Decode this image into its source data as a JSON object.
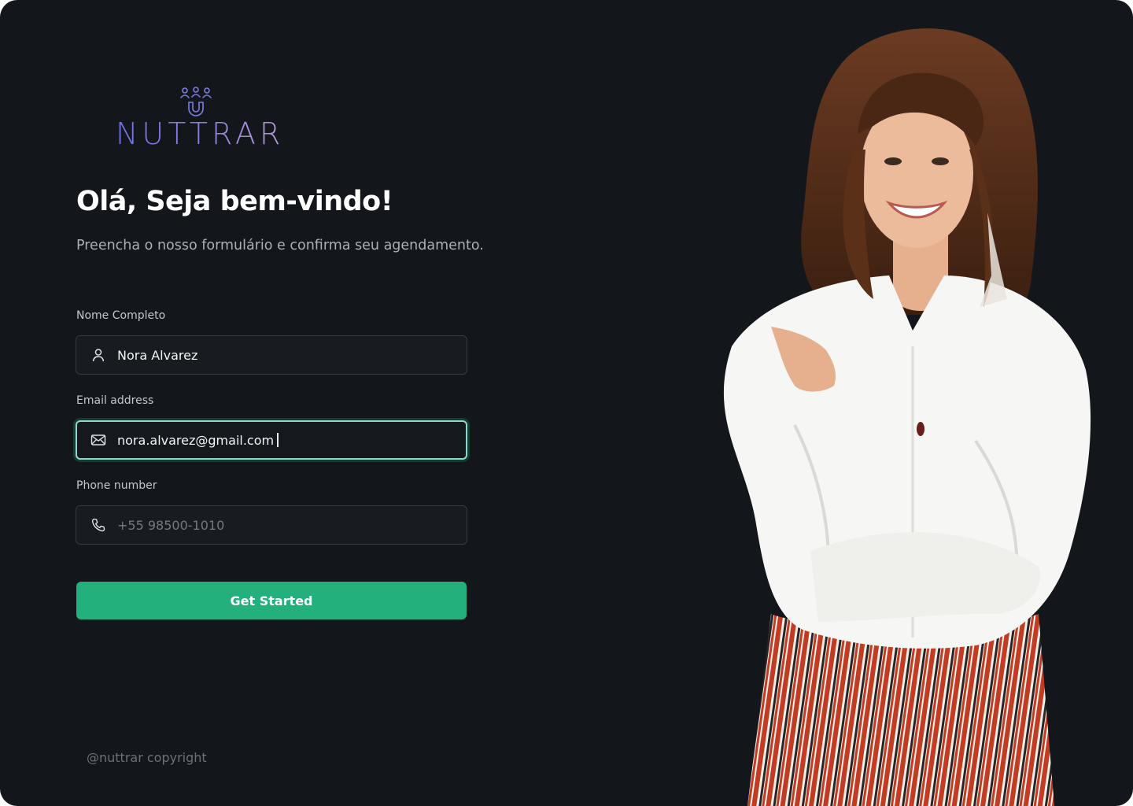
{
  "brand": {
    "name": "NUTTRAR",
    "logo_icon": "people-magnet-icon",
    "colors": {
      "primary": "#6f72e8",
      "accent": "#b79ad8"
    }
  },
  "hero": {
    "title": "Olá, Seja bem-vindo!",
    "subtitle": "Preencha o nosso formulário e  confirma seu agendamento."
  },
  "form": {
    "name": {
      "label": "Nome Completo",
      "value": "Nora Alvarez",
      "icon": "user-icon"
    },
    "email": {
      "label": "Email address",
      "value": "nora.alvarez@gmail.com",
      "icon": "mail-icon",
      "focused": true
    },
    "phone": {
      "label": "Phone number",
      "placeholder": "+55 98500-1010",
      "icon": "phone-icon"
    },
    "submit_label": "Get Started"
  },
  "footer": {
    "copyright": "@nuttrar copyright"
  },
  "colors": {
    "background": "#13171b",
    "button": "#23b07d",
    "focus_ring": "#8fd6cf"
  }
}
